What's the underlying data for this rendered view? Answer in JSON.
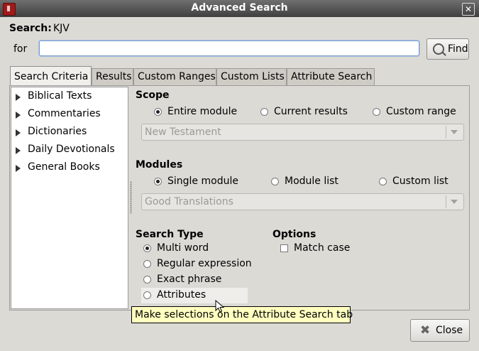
{
  "window": {
    "title": "Advanced Search",
    "close_icon": "close-icon",
    "app_icon": "bible-app-icon"
  },
  "search": {
    "label": "Search:",
    "module": "KJV",
    "for_label": "for",
    "input_value": "",
    "find_label": "Find"
  },
  "tabs": [
    {
      "label": "Search  Criteria",
      "active": true
    },
    {
      "label": "Results"
    },
    {
      "label": "Custom Ranges"
    },
    {
      "label": "Custom Lists"
    },
    {
      "label": "Attribute Search"
    }
  ],
  "tree": {
    "items": [
      "Biblical Texts",
      "Commentaries",
      "Dictionaries",
      "Daily Devotionals",
      "General Books"
    ]
  },
  "scope": {
    "heading": "Scope",
    "options": [
      "Entire module",
      "Current results",
      "Custom range"
    ],
    "selected": "Entire module",
    "combo_value": "New Testament"
  },
  "modules": {
    "heading": "Modules",
    "options": [
      "Single module",
      "Module list",
      "Custom list"
    ],
    "selected": "Single module",
    "combo_value": "Good Translations"
  },
  "search_type": {
    "heading": "Search Type",
    "options": [
      "Multi word",
      "Regular expression",
      "Exact phrase",
      "Attributes"
    ],
    "selected": "Multi word"
  },
  "options": {
    "heading": "Options",
    "match_case_label": "Match case",
    "match_case_checked": false
  },
  "tooltip": "Make selections on the Attribute Search tab",
  "buttons": {
    "close_label": "Close"
  }
}
